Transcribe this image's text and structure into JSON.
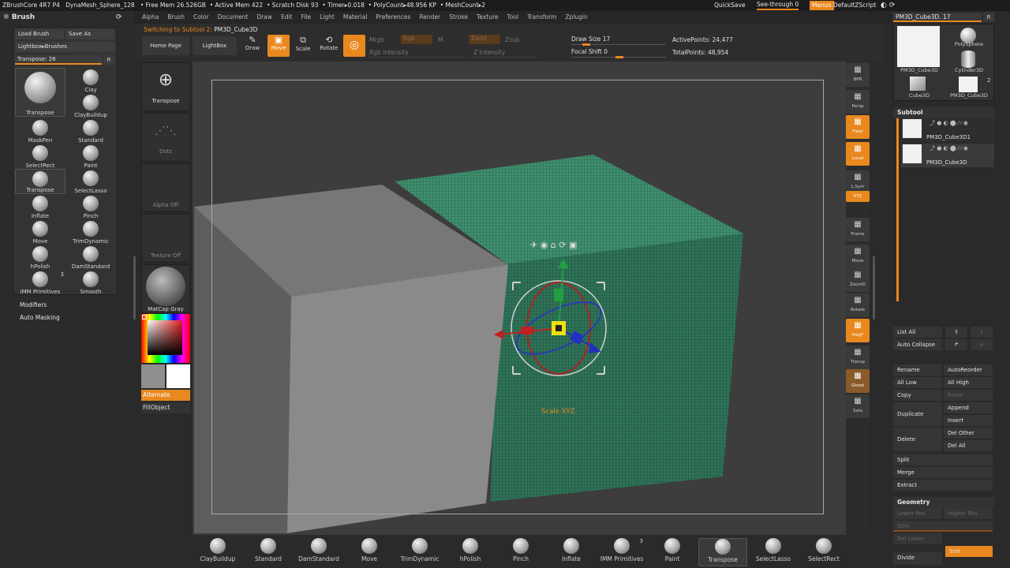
{
  "titlebar": {
    "app": "ZBrushCore 4R7 P4",
    "mesh": "DynaMesh_Sphere_128",
    "free_mem": "• Free Mem 26.526GB",
    "active_mem": "• Active Mem 422",
    "scratch": "• Scratch Disk 93",
    "timer": "• Timer▸0.018",
    "polycount": "• PolyCount▸48.956 KP",
    "meshcount": "• MeshCount▸2",
    "quicksave": "QuickSave",
    "seethrough": "See-through 0",
    "menus": "Menus",
    "defaultzscript": "DefaultZScript"
  },
  "menubar": [
    "Alpha",
    "Brush",
    "Color",
    "Document",
    "Draw",
    "Edit",
    "File",
    "Light",
    "Material",
    "Preferences",
    "Render",
    "Stroke",
    "Texture",
    "Tool",
    "Transform",
    "Zplugin"
  ],
  "left": {
    "title": "Brush",
    "load_brush": "Load Brush",
    "save_as": "Save As",
    "lightbox_brushes": "Lightbox▸Brushes",
    "transpose_slider": "Transpose: 26",
    "transpose_r": "R",
    "brushes": [
      {
        "label": "Transpose",
        "icon": "transpose-icon"
      },
      {
        "label": "Clay",
        "icon": "clay-icon"
      },
      {
        "label": "ClayBuildup",
        "icon": "claybuildup-icon"
      },
      {
        "label": "MaskPen",
        "icon": "maskpen-icon"
      },
      {
        "label": "Standard",
        "icon": "standard-icon"
      },
      {
        "label": "SelectRect",
        "icon": "selectrect-icon"
      },
      {
        "label": "Paint",
        "icon": "paint-icon"
      },
      {
        "label": "Transpose",
        "icon": "transpose-icon"
      },
      {
        "label": "SelectLasso",
        "icon": "selectlasso-icon"
      },
      {
        "label": "Inflate",
        "icon": "inflate-icon"
      },
      {
        "label": "Pinch",
        "icon": "pinch-icon"
      },
      {
        "label": "Move",
        "icon": "move-icon"
      },
      {
        "label": "TrimDynamic",
        "icon": "trimdynamic-icon"
      },
      {
        "label": "hPolish",
        "icon": "hpolish-icon"
      },
      {
        "label": "DamStandard",
        "icon": "damstandard-icon"
      },
      {
        "label": "IMM Primitives",
        "icon": "imm-primitives-icon",
        "badge": "3"
      },
      {
        "label": "Smooth",
        "icon": "smooth-icon"
      }
    ],
    "modifiers": "Modifiers",
    "auto_masking": "Auto Masking"
  },
  "shelf": {
    "status": "Switching to Subtool 2:",
    "status_name": "PM3D_Cube3D",
    "home_page": "Home Page",
    "lightbox": "LightBox",
    "draw": "Draw",
    "move": "Move",
    "scale": "Scale",
    "rotate": "Rotate",
    "mrgb": "Mrgb",
    "rgb": "Rgb",
    "m": "M",
    "zadd": "Zadd",
    "zsub": "Zsub",
    "rgb_intensity": "Rgb Intensity",
    "z_intensity": "Z Intensity",
    "draw_size": "Draw Size 17",
    "focal_shift": "Focal Shift 0",
    "active_points": "ActivePoints: 24,477",
    "total_points": "TotalPoints: 48,954"
  },
  "lefttools": {
    "transpose": "Transpose",
    "dots": "Dots",
    "alpha_off": "Alpha Off",
    "texture_off": "Texture Off",
    "matcap": "MatCap Gray",
    "alternate": "Alternate",
    "fillobject": "FillObject"
  },
  "viewport": {
    "scale_xyz": "Scale XYZ"
  },
  "rightstrip": [
    "BPR",
    "Persp",
    "Floor",
    "Local",
    "L.Sym",
    "XYZ",
    "Frame",
    "Move",
    "ZoomD",
    "Rotate",
    "PolyF",
    "Transp",
    "Ghost",
    "Solo"
  ],
  "rightpanel": {
    "tool_name": "PM3D_Cube3D. 17",
    "tool_r": "R",
    "thumbs": [
      "PM3D_Cube3D",
      "PolySphere",
      "Cylinder3D",
      "Cube3D",
      "PM3D_Cube3D"
    ],
    "thumb_badge": "2",
    "subtool_title": "Subtool",
    "subtools": [
      "PM3D_Cube3D1",
      "PM3D_Cube3D"
    ],
    "list_all": "List All",
    "auto_collapse": "Auto Collapse",
    "rename": "Rename",
    "autoreorder": "AutoReorder",
    "all_low": "All Low",
    "all_high": "All High",
    "copy": "Copy",
    "paste": "Paste",
    "duplicate": "Duplicate",
    "append": "Append",
    "insert": "Insert",
    "delete": "Delete",
    "del_other": "Del Other",
    "del_all": "Del All",
    "split": "Split",
    "merge": "Merge",
    "extract": "Extract",
    "geometry": "Geometry",
    "lower_res": "Lower Res",
    "higher_res": "Higher Res",
    "sdiv": "SDiv",
    "del_lower": "Del Lower",
    "smt": "Smt",
    "divide": "Divide"
  },
  "bottombar": [
    {
      "label": "ClayBuildup",
      "icon": "claybuildup-icon"
    },
    {
      "label": "Standard",
      "icon": "standard-icon"
    },
    {
      "label": "DamStandard",
      "icon": "damstandard-icon"
    },
    {
      "label": "Move",
      "icon": "move-icon"
    },
    {
      "label": "TrimDynamic",
      "icon": "trimdynamic-icon"
    },
    {
      "label": "hPolish",
      "icon": "hpolish-icon"
    },
    {
      "label": "Pinch",
      "icon": "pinch-icon"
    },
    {
      "label": "Inflate",
      "icon": "inflate-icon"
    },
    {
      "label": "IMM Primitives",
      "icon": "imm-primitives-icon",
      "badge": "3"
    },
    {
      "label": "Paint",
      "icon": "paint-icon"
    },
    {
      "label": "Transpose",
      "icon": "transpose-icon"
    },
    {
      "label": "SelectLasso",
      "icon": "selectlasso-icon"
    },
    {
      "label": "SelectRect",
      "icon": "selectrect-icon"
    }
  ],
  "colors": {
    "accent_orange": "#e8881e",
    "mesh_green": "#3f8f6e",
    "gray_cube": "#8a8a8a"
  }
}
